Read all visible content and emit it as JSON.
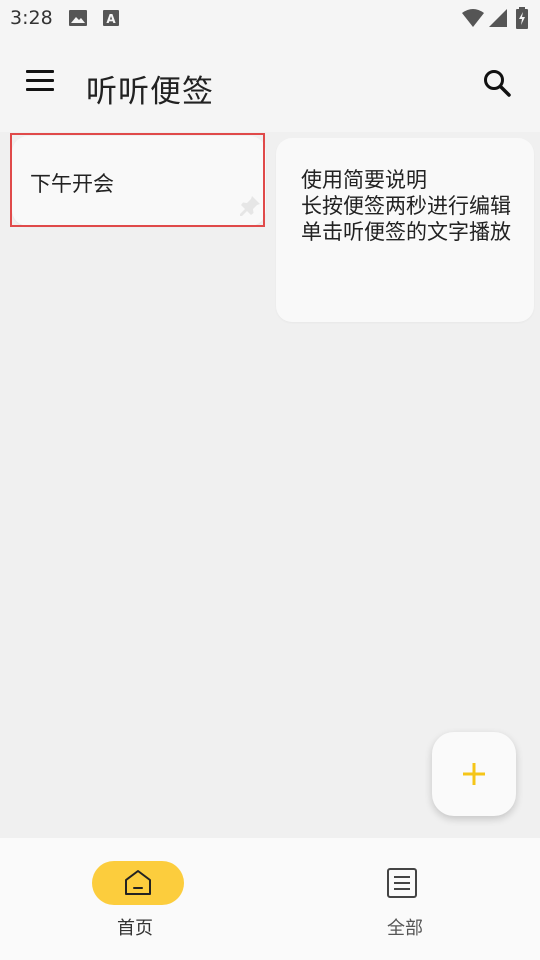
{
  "status_bar": {
    "time": "3:28",
    "icons": [
      "image-icon",
      "font-a-icon",
      "wifi-icon",
      "signal-icon",
      "battery-charging-icon"
    ]
  },
  "app_bar": {
    "title": "听听便签",
    "menu_icon": "hamburger-menu-icon",
    "search_icon": "search-icon"
  },
  "notes": [
    {
      "text": "下午开会",
      "pinned": true
    },
    {
      "lines": [
        "使用简要说明",
        "长按便签两秒进行编辑",
        "单击听便签的文字播放"
      ]
    }
  ],
  "fab": {
    "icon": "plus-icon",
    "color": "#f5c518"
  },
  "bottom_nav": {
    "items": [
      {
        "label": "首页",
        "icon": "home-icon",
        "active": true
      },
      {
        "label": "全部",
        "icon": "list-icon",
        "active": false
      }
    ],
    "active_color": "#fccd3d"
  },
  "highlight_color": "#e04a4a"
}
